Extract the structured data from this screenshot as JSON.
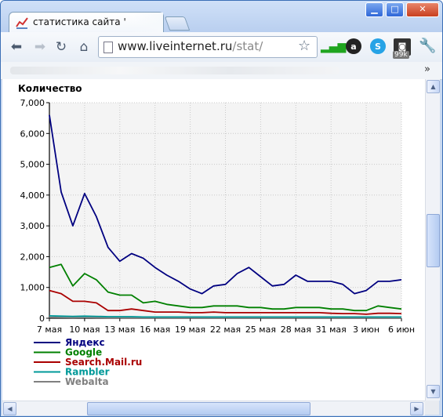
{
  "tab": {
    "title": "статистика сайта '",
    "favicon": "chart-line-icon"
  },
  "toolbar": {
    "url_host": "www.liveinternet.ru",
    "url_path": "/stat/",
    "ext_badge": "99k",
    "icons": [
      "back-arrow-icon",
      "forward-arrow-icon",
      "reload-icon",
      "home-icon",
      "star-icon",
      "signal-bars-icon",
      "extension-a-icon",
      "skype-icon",
      "rss-icon",
      "wrench-icon"
    ]
  },
  "bookmarks": {
    "more": "»"
  },
  "chart_data": {
    "type": "line",
    "ylabel": "Количество",
    "ylim": [
      0,
      7000
    ],
    "yticks": [
      "0",
      "1,000",
      "2,000",
      "3,000",
      "4,000",
      "5,000",
      "6,000",
      "7,000"
    ],
    "xticks": [
      "7 мая",
      "10 мая",
      "13 мая",
      "16 мая",
      "19 мая",
      "22 мая",
      "25 мая",
      "28 мая",
      "31 мая",
      "3 июн",
      "6 июн"
    ],
    "n_points": 31,
    "grid": true,
    "legend_position": "bottom-left",
    "series": [
      {
        "name": "Яндекс",
        "color": "#000080",
        "values": [
          6600,
          4100,
          3000,
          4050,
          3300,
          2300,
          1850,
          2100,
          1950,
          1650,
          1400,
          1200,
          950,
          800,
          1050,
          1100,
          1450,
          1650,
          1350,
          1050,
          1100,
          1400,
          1200,
          1200,
          1200,
          1100,
          800,
          900,
          1200,
          1200,
          1250
        ]
      },
      {
        "name": "Google",
        "color": "#008000",
        "values": [
          1650,
          1750,
          1050,
          1450,
          1250,
          850,
          750,
          750,
          500,
          550,
          450,
          400,
          350,
          350,
          400,
          400,
          400,
          350,
          350,
          300,
          300,
          350,
          350,
          350,
          300,
          300,
          250,
          250,
          400,
          350,
          300
        ]
      },
      {
        "name": "Search.Mail.ru",
        "color": "#aa0000",
        "values": [
          900,
          800,
          550,
          550,
          500,
          250,
          250,
          300,
          250,
          200,
          200,
          200,
          180,
          180,
          200,
          180,
          180,
          180,
          180,
          180,
          180,
          180,
          180,
          180,
          160,
          150,
          150,
          130,
          160,
          160,
          150
        ]
      },
      {
        "name": "Rambler",
        "color": "#009999",
        "values": [
          80,
          70,
          60,
          70,
          60,
          50,
          50,
          50,
          40,
          40,
          40,
          40,
          40,
          40,
          40,
          40,
          40,
          40,
          40,
          40,
          40,
          40,
          40,
          40,
          40,
          40,
          40,
          40,
          40,
          40,
          40
        ]
      },
      {
        "name": "Webalta",
        "color": "#808080",
        "values": [
          30,
          25,
          20,
          25,
          20,
          15,
          15,
          15,
          15,
          15,
          15,
          15,
          15,
          15,
          15,
          15,
          15,
          15,
          15,
          15,
          15,
          15,
          15,
          15,
          15,
          15,
          15,
          15,
          15,
          15,
          15
        ]
      }
    ]
  }
}
